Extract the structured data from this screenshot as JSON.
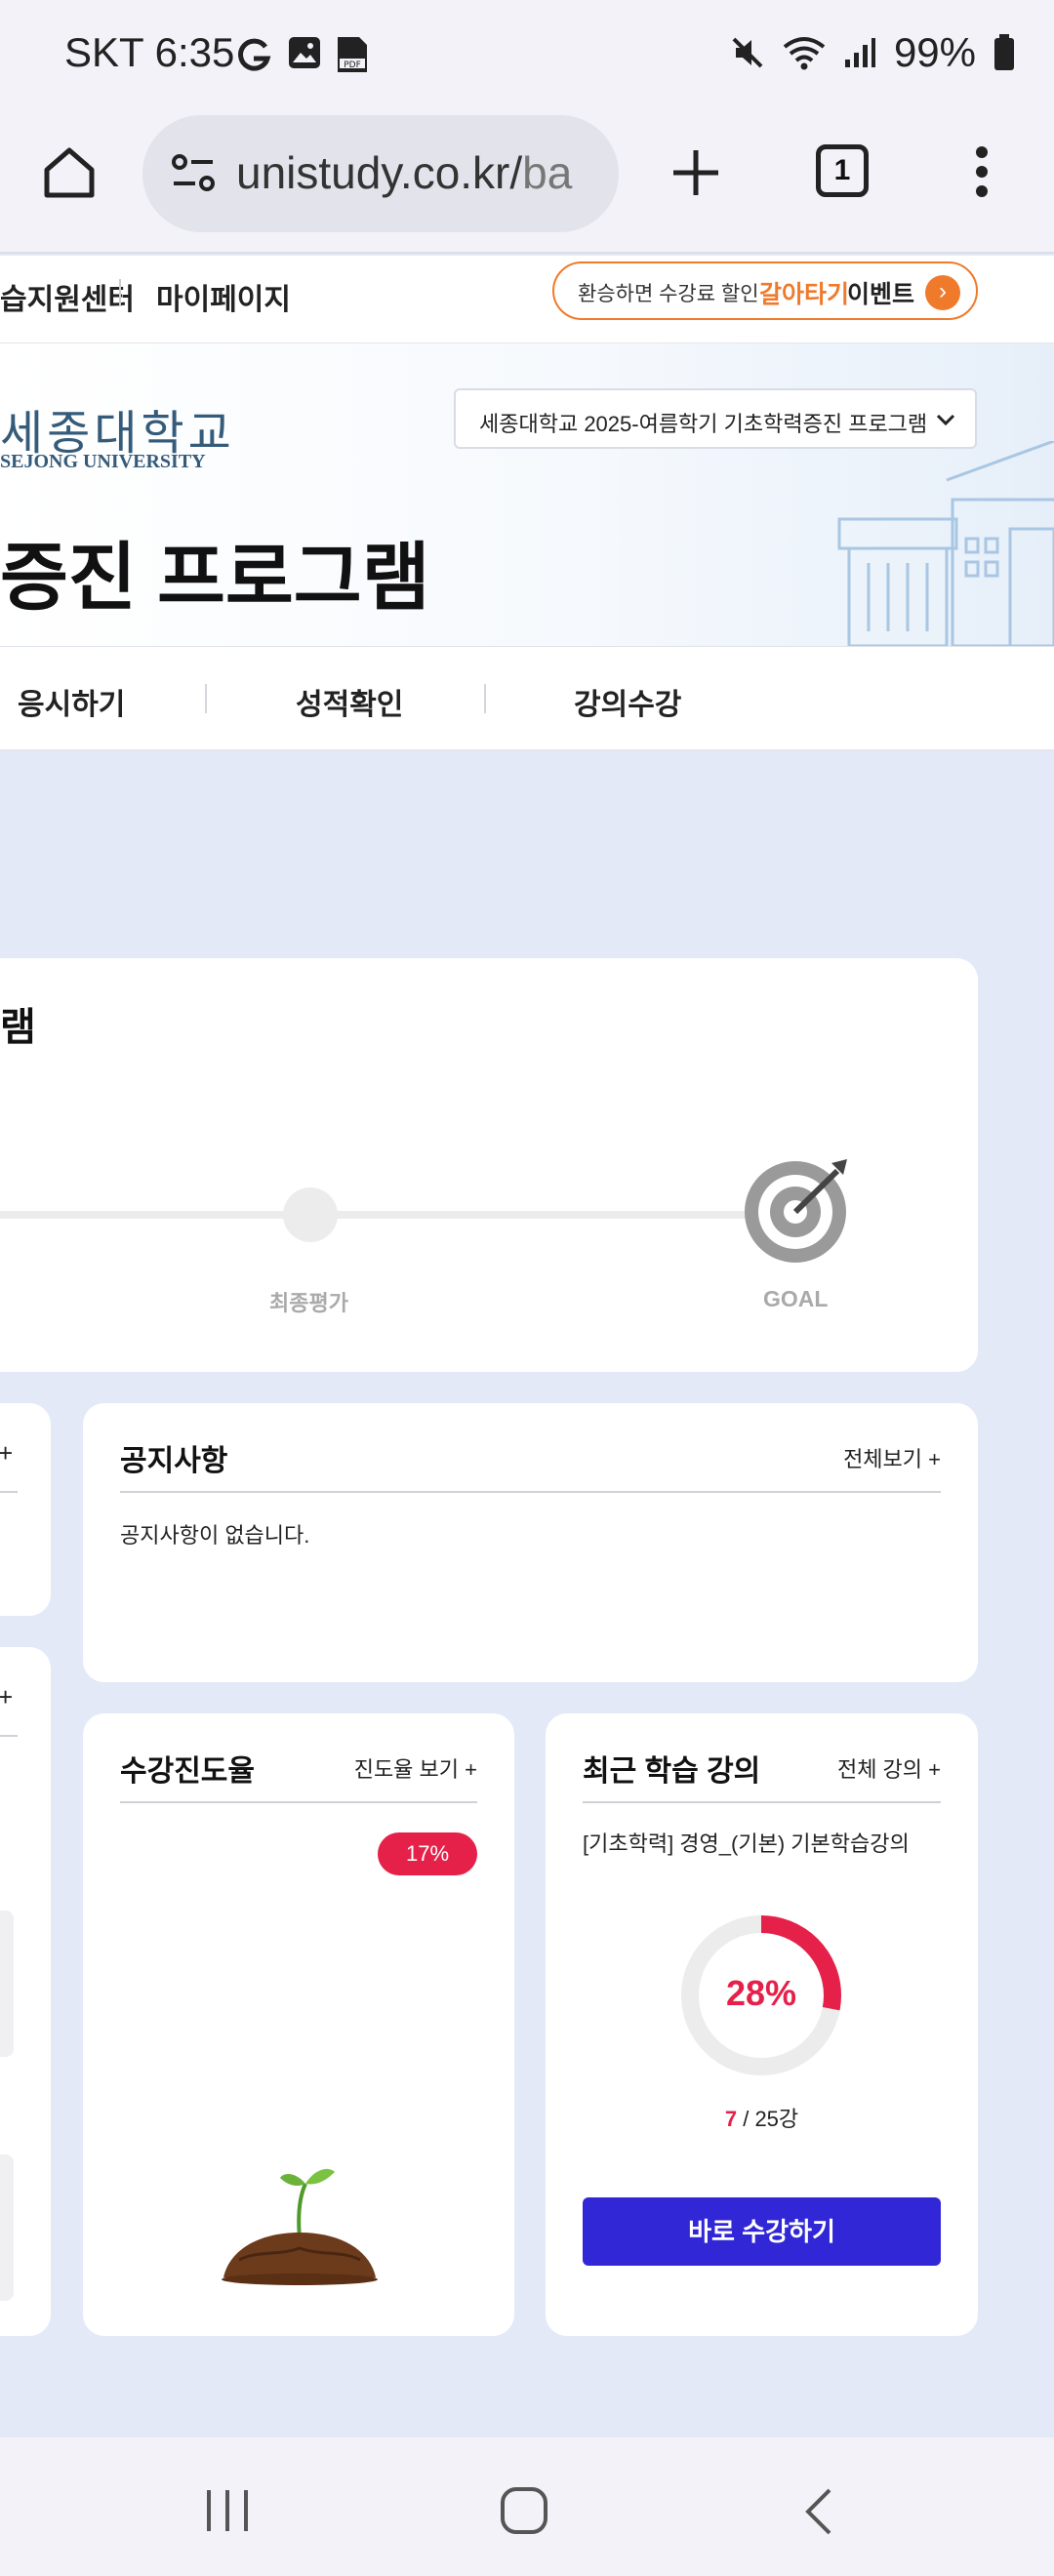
{
  "status": {
    "time": "SKT 6:35",
    "battery": "99%"
  },
  "browser": {
    "url_main": "unistudy.co.kr/",
    "url_fade": "ba",
    "tab_count": "1"
  },
  "topstrip": {
    "link1": "습지원센터",
    "link2": "마이페이지",
    "event_text1": "환승하면 수강료 할인",
    "event_text2": "갈아타기",
    "event_text3": "이벤트"
  },
  "header": {
    "logo_ko": "세종대학교",
    "logo_en": "SEJONG UNIVERSITY",
    "program_select": "세종대학교 2025-여름학기 기초학력증진 프로그램",
    "page_title": "증진 프로그램"
  },
  "nav": {
    "tabs": [
      "응시하기",
      "성적확인",
      "강의수강"
    ]
  },
  "roadmap": {
    "title": "램",
    "steps": [
      "최종평가",
      "GOAL"
    ]
  },
  "notice": {
    "title": "공지사항",
    "more": "전체보기",
    "empty": "공지사항이 없습니다."
  },
  "progress_card": {
    "title": "수강진도율",
    "more": "진도율 보기",
    "badge": "17%",
    "progress_value": 17
  },
  "recent": {
    "title": "최근 학습 강의",
    "more": "전체 강의",
    "course": "[기초학력] 경영_(기본) 기본학습강의",
    "percent_text": "28%",
    "percent_value": 28,
    "done": "7",
    "total": "/ 25강",
    "cta": "바로 수강하기"
  },
  "colors": {
    "accent": "#3127d6",
    "danger": "#e5214a",
    "orange": "#f07a2b"
  }
}
